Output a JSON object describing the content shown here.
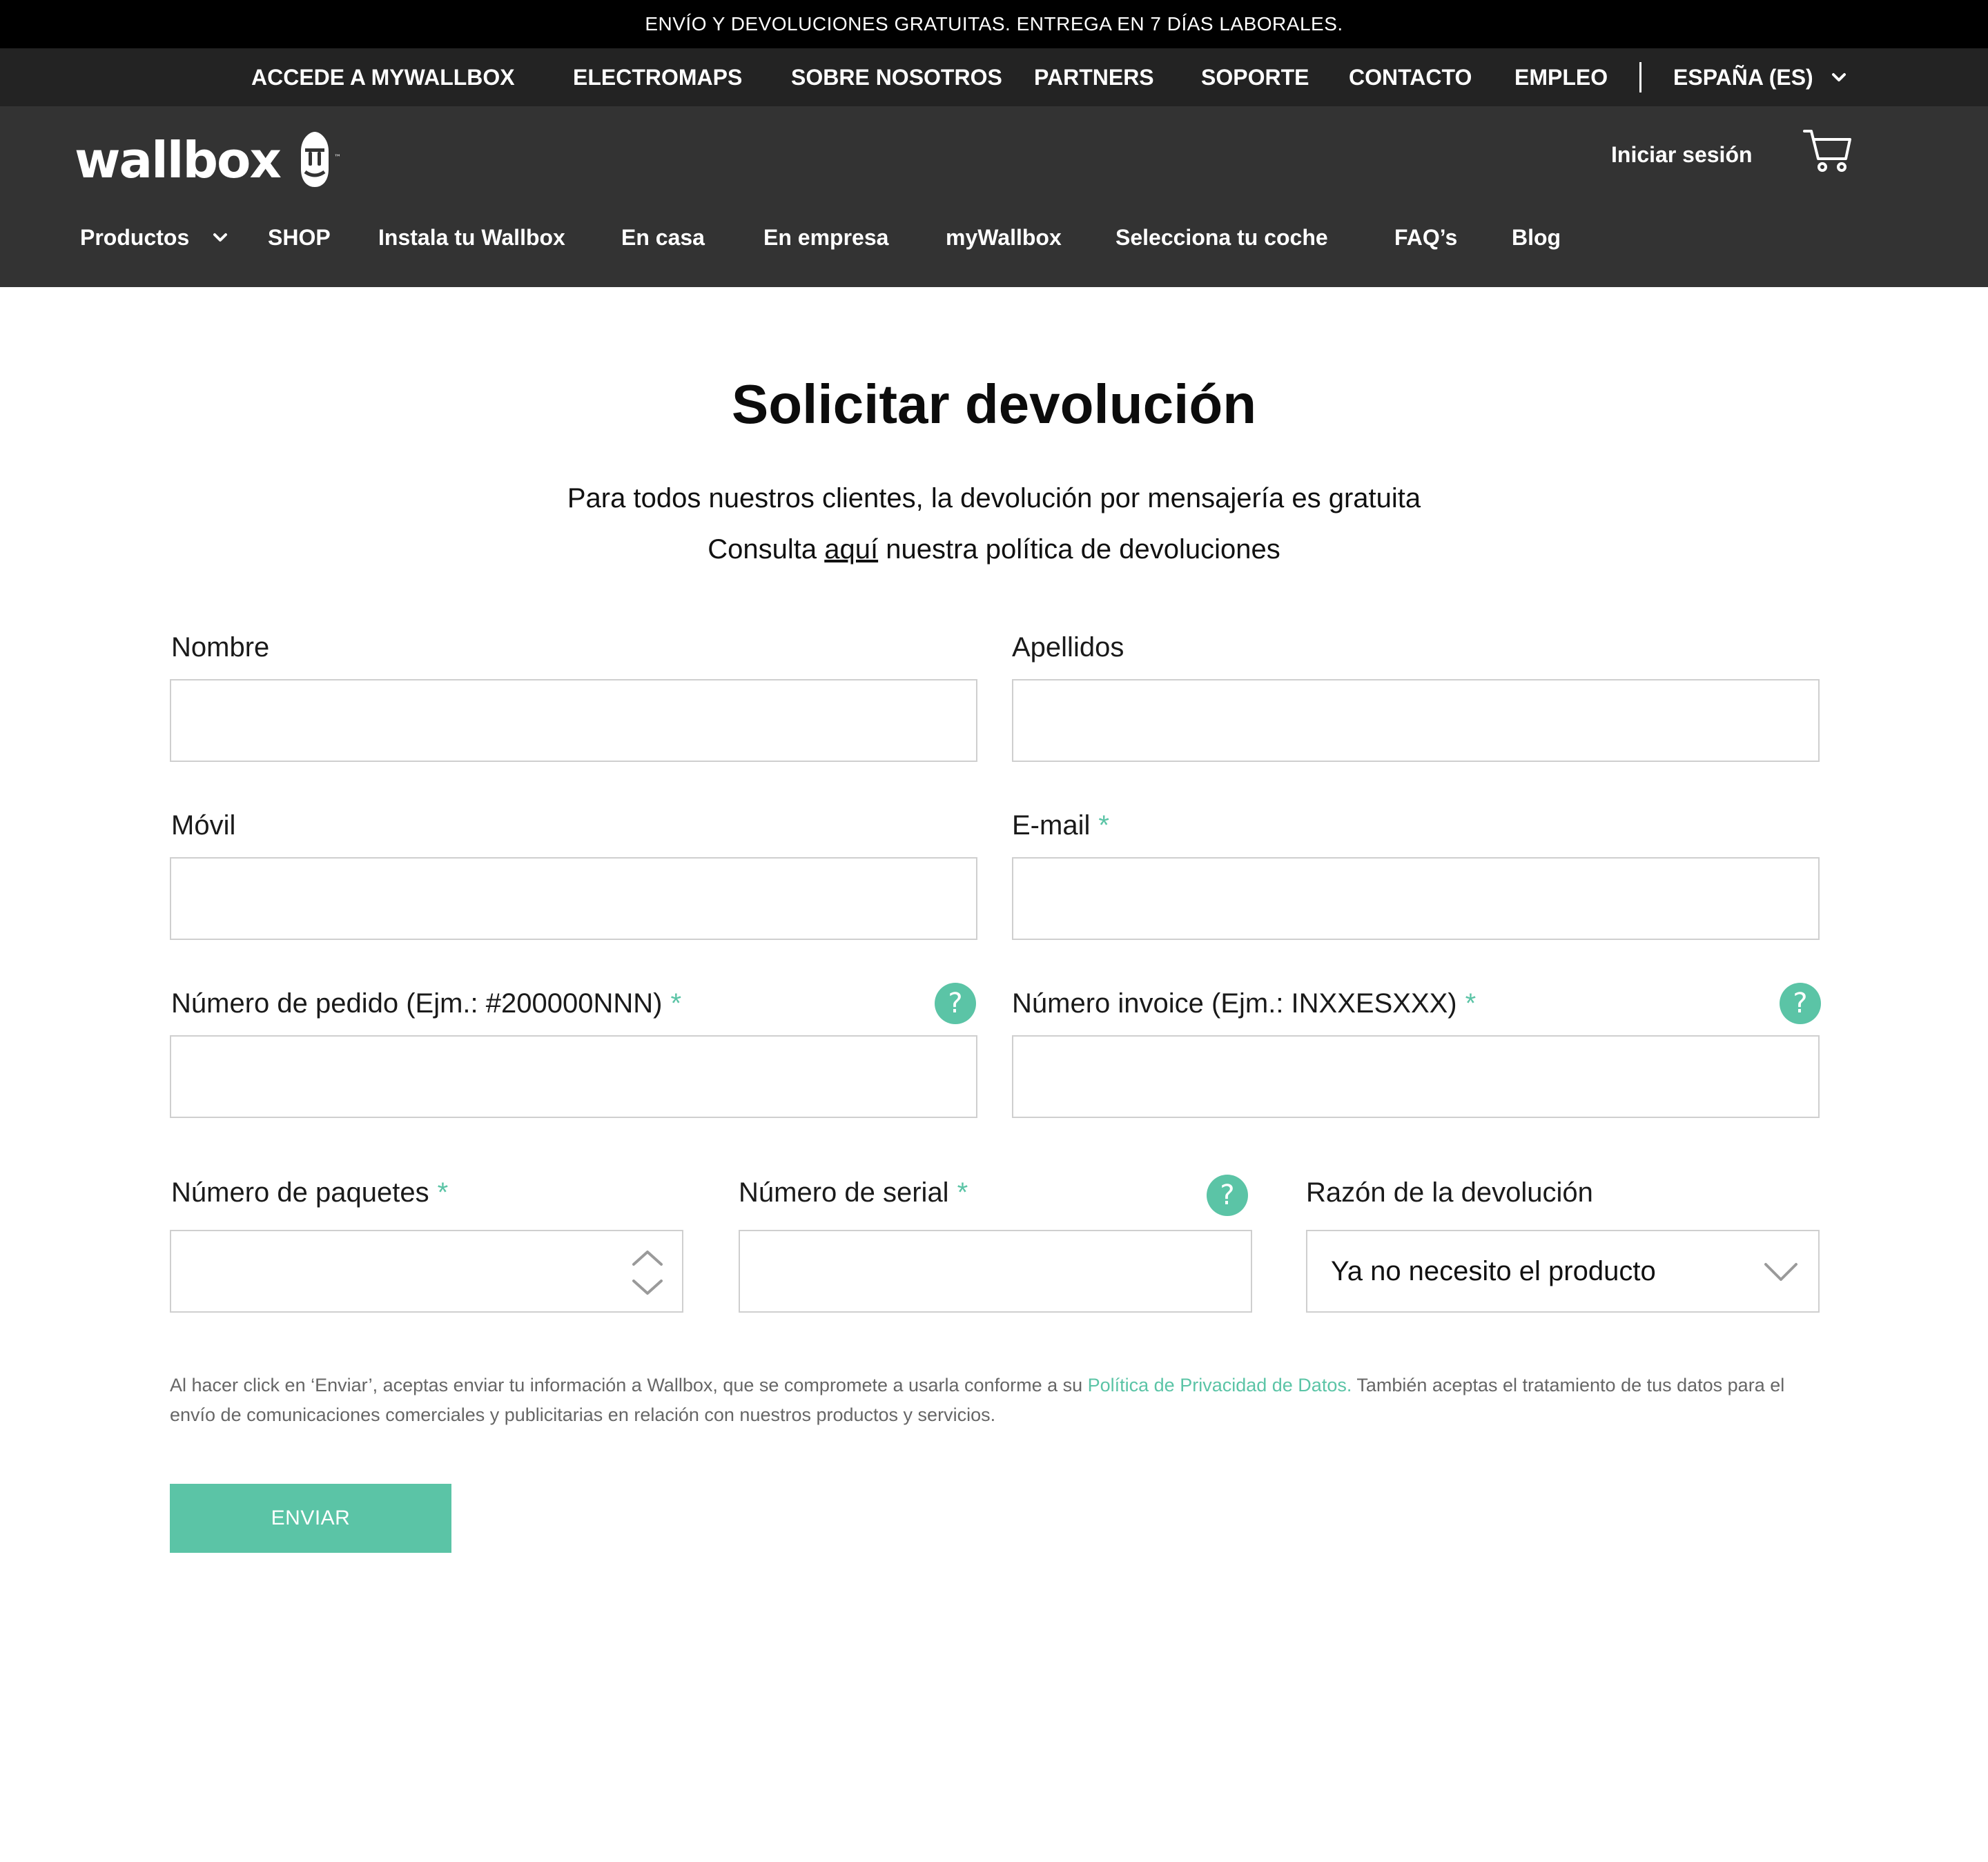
{
  "promo": {
    "text": "ENVÍO Y DEVOLUCIONES GRATUITAS. ENTREGA EN 7 DÍAS LABORALES."
  },
  "topnav": {
    "items": [
      "ACCEDE A MYWALLBOX",
      "ELECTROMAPS",
      "SOBRE NOSOTROS",
      "PARTNERS",
      "SOPORTE",
      "CONTACTO",
      "EMPLEO"
    ],
    "region": "ESPAÑA (ES)"
  },
  "header": {
    "brand": "wallbox",
    "signin": "Iniciar sesión"
  },
  "mainnav": {
    "items": [
      "Productos",
      "SHOP",
      "Instala tu Wallbox",
      "En casa",
      "En empresa",
      "myWallbox",
      "Selecciona tu coche",
      "FAQ’s",
      "Blog"
    ]
  },
  "page": {
    "title": "Solicitar devolución",
    "subtitle": "Para todos nuestros clientes, la devolución por mensajería es gratuita",
    "policy_before": "Consulta ",
    "policy_link": "aquí",
    "policy_after": " nuestra política de devoluciones"
  },
  "form": {
    "required_mark": "*",
    "help_glyph": "?",
    "nombre": {
      "label": "Nombre",
      "value": ""
    },
    "apellidos": {
      "label": "Apellidos",
      "value": ""
    },
    "movil": {
      "label": "Móvil",
      "value": ""
    },
    "email": {
      "label": "E-mail",
      "value": ""
    },
    "pedido": {
      "label": "Número de pedido (Ejm.: #200000NNN)",
      "value": ""
    },
    "invoice": {
      "label": "Número invoice (Ejm.: INXXESXXX)",
      "value": ""
    },
    "paquetes": {
      "label": "Número de paquetes",
      "value": ""
    },
    "serial": {
      "label": "Número de serial",
      "value": ""
    },
    "razon": {
      "label": "Razón de la devolución",
      "selected": "Ya no necesito el producto"
    },
    "legal_before": "Al hacer click en ‘Enviar’, aceptas enviar tu información a Wallbox, que se compromete a usarla conforme a su ",
    "legal_link": "Política de Privacidad de Datos.",
    "legal_after": " También aceptas el tratamiento de tus datos para el envío de comunicaciones comerciales y publicitarias en relación con nuestros productos y servicios.",
    "submit": "ENVIAR"
  },
  "colors": {
    "accent": "#5bc4a6",
    "promo_bg": "#000000",
    "topnav_bg": "#232323",
    "header_bg": "#333333"
  },
  "icons": [
    "chevron-down-icon",
    "wallbox-logo-icon",
    "cart-icon",
    "help-icon",
    "stepper-icon"
  ]
}
